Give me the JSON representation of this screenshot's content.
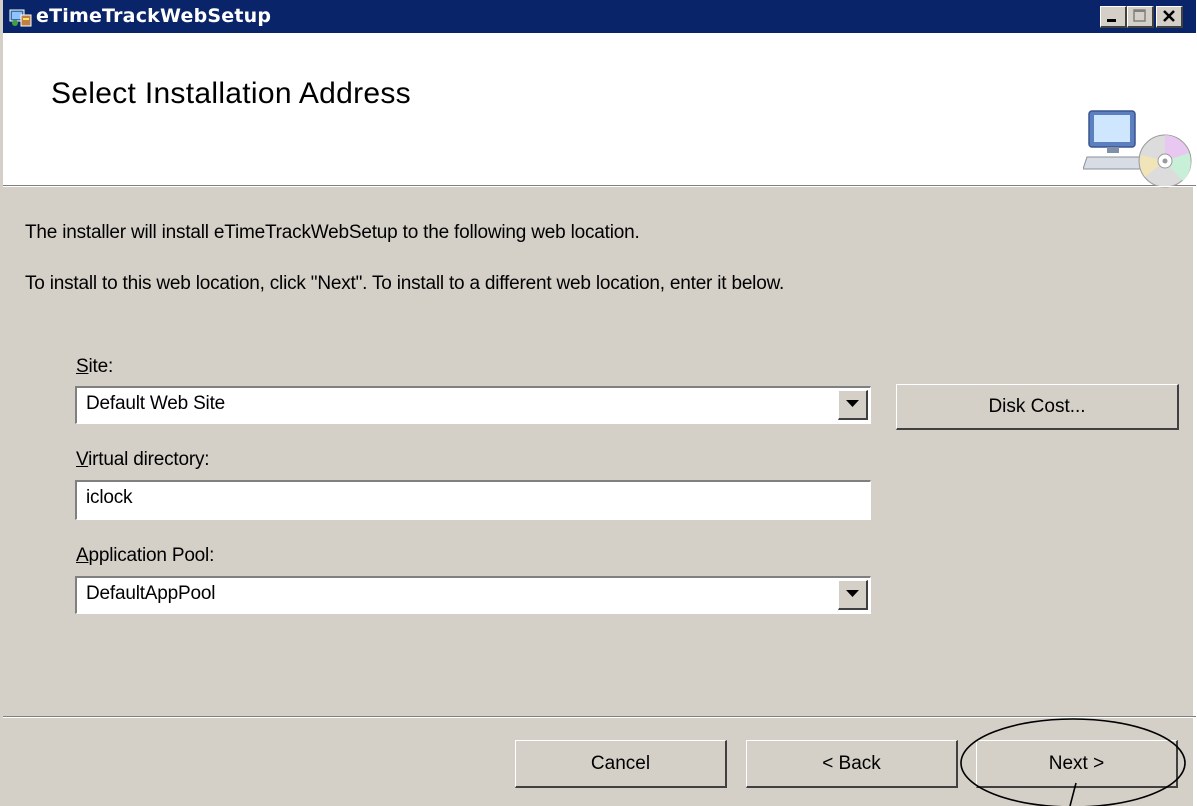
{
  "window": {
    "title": "eTimeTrackWebSetup",
    "icon": "installer-icon",
    "controls": [
      "minimize",
      "maximize",
      "close"
    ]
  },
  "header": {
    "title": "Select Installation Address",
    "icon": "computer-disc-icon"
  },
  "intro": {
    "line1": "The installer will install eTimeTrackWebSetup to the following web location.",
    "line2": "To install to this web location, click \"Next\". To install to a different web location, enter it below."
  },
  "fields": {
    "site": {
      "label_accel": "S",
      "label_rest": "ite:",
      "value": "Default Web Site"
    },
    "virtual_directory": {
      "label_accel": "V",
      "label_rest": "irtual directory:",
      "value": "iclock"
    },
    "application_pool": {
      "label_accel": "A",
      "label_rest": "pplication Pool:",
      "value": "DefaultAppPool"
    }
  },
  "buttons": {
    "disk_cost": "Disk Cost...",
    "cancel": "Cancel",
    "back": "< Back",
    "next": "Next >"
  },
  "colors": {
    "titlebar": "#0a246a",
    "face": "#d4d0c8",
    "annotation": "#000000"
  }
}
